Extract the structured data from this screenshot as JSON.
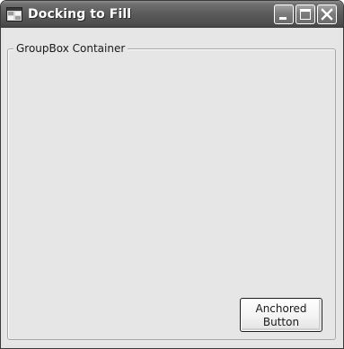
{
  "window": {
    "title": "Docking to Fill",
    "icon": "app-window-icon",
    "controls": {
      "minimize": "minimize-icon",
      "maximize": "maximize-icon",
      "close": "close-icon"
    }
  },
  "groupbox": {
    "label": "GroupBox Container"
  },
  "button": {
    "line1": "Anchored",
    "line2": "Button"
  },
  "colors": {
    "titlebar": "#5a5a5a",
    "client_background": "#e6e6e6",
    "title_text": "#ffffff"
  }
}
